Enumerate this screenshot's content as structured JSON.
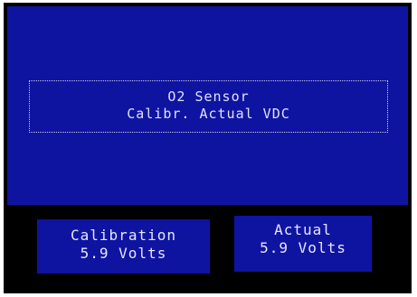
{
  "header": {
    "title_line1": "O2 Sensor",
    "title_line2": "Calibr. Actual VDC"
  },
  "readouts": {
    "calibration": {
      "label": "Calibration",
      "value": "5.9 Volts"
    },
    "actual": {
      "label": "Actual",
      "value": "5.9 Volts"
    }
  },
  "colors": {
    "screen_blue": "#0f14a0",
    "bezel_black": "#000000",
    "text_light": "#e6e6ff"
  }
}
